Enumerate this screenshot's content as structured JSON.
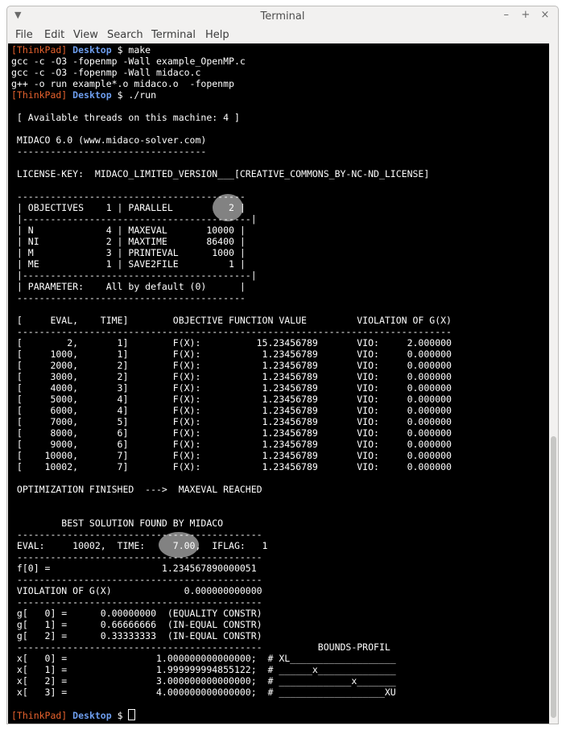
{
  "window": {
    "title": "Terminal",
    "menu_icon": "chevron-down-icon",
    "controls": [
      "–",
      "+",
      "×"
    ]
  },
  "menubar": [
    "File",
    "Edit",
    "View",
    "Search",
    "Terminal",
    "Help"
  ],
  "terminal": {
    "lines": [
      [
        {
          "t": "[ThinkPad] ",
          "c": "host"
        },
        {
          "t": "Desktop",
          "c": "dir"
        },
        {
          "t": " $ make"
        }
      ],
      [
        {
          "t": "gcc -c -O3 -fopenmp -Wall example_OpenMP.c"
        }
      ],
      [
        {
          "t": "gcc -c -O3 -fopenmp -Wall midaco.c"
        }
      ],
      [
        {
          "t": "g++ -o run example*.o midaco.o  -fopenmp"
        }
      ],
      [
        {
          "t": "[ThinkPad] ",
          "c": "host"
        },
        {
          "t": "Desktop",
          "c": "dir"
        },
        {
          "t": " $ ./run"
        }
      ],
      [
        {
          "t": ""
        }
      ],
      [
        {
          "t": " [ Available threads on this machine: 4 ]"
        }
      ],
      [
        {
          "t": ""
        }
      ],
      [
        {
          "t": " MIDACO 6.0 (www.midaco-solver.com)"
        }
      ],
      [
        {
          "t": " ----------------------------------"
        }
      ],
      [
        {
          "t": ""
        }
      ],
      [
        {
          "t": " LICENSE-KEY:  MIDACO_LIMITED_VERSION___[CREATIVE_COMMONS_BY-NC-ND_LICENSE]"
        }
      ],
      [
        {
          "t": ""
        }
      ],
      [
        {
          "t": " -----------------------------------------"
        }
      ],
      [
        {
          "t": " | OBJECTIVES    1 | PARALLEL          2 |"
        }
      ],
      [
        {
          "t": " |-----------------------------------------|"
        }
      ],
      [
        {
          "t": " | N             4 | MAXEVAL       10000 |"
        }
      ],
      [
        {
          "t": " | NI            2 | MAXTIME       86400 |"
        }
      ],
      [
        {
          "t": " | M             3 | PRINTEVAL      1000 |"
        }
      ],
      [
        {
          "t": " | ME            1 | SAVE2FILE         1 |"
        }
      ],
      [
        {
          "t": " |-----------------------------------------|"
        }
      ],
      [
        {
          "t": " | PARAMETER:    All by default (0)      |"
        }
      ],
      [
        {
          "t": " -----------------------------------------"
        }
      ],
      [
        {
          "t": ""
        }
      ],
      [
        {
          "t": " [     EVAL,    TIME]        OBJECTIVE FUNCTION VALUE         VIOLATION OF G(X)"
        }
      ],
      [
        {
          "t": " ------------------------------------------------------------------------------"
        }
      ],
      [
        {
          "t": " [        2,       1]        F(X):          15.23456789       VIO:     2.000000"
        }
      ],
      [
        {
          "t": " [     1000,       1]        F(X):           1.23456789       VIO:     0.000000"
        }
      ],
      [
        {
          "t": " [     2000,       2]        F(X):           1.23456789       VIO:     0.000000"
        }
      ],
      [
        {
          "t": " [     3000,       2]        F(X):           1.23456789       VIO:     0.000000"
        }
      ],
      [
        {
          "t": " [     4000,       3]        F(X):           1.23456789       VIO:     0.000000"
        }
      ],
      [
        {
          "t": " [     5000,       4]        F(X):           1.23456789       VIO:     0.000000"
        }
      ],
      [
        {
          "t": " [     6000,       4]        F(X):           1.23456789       VIO:     0.000000"
        }
      ],
      [
        {
          "t": " [     7000,       5]        F(X):           1.23456789       VIO:     0.000000"
        }
      ],
      [
        {
          "t": " [     8000,       6]        F(X):           1.23456789       VIO:     0.000000"
        }
      ],
      [
        {
          "t": " [     9000,       6]        F(X):           1.23456789       VIO:     0.000000"
        }
      ],
      [
        {
          "t": " [    10000,       7]        F(X):           1.23456789       VIO:     0.000000"
        }
      ],
      [
        {
          "t": " [    10002,       7]        F(X):           1.23456789       VIO:     0.000000"
        }
      ],
      [
        {
          "t": ""
        }
      ],
      [
        {
          "t": " OPTIMIZATION FINISHED  --->  MAXEVAL REACHED"
        }
      ],
      [
        {
          "t": ""
        }
      ],
      [
        {
          "t": ""
        }
      ],
      [
        {
          "t": "         BEST SOLUTION FOUND BY MIDACO"
        }
      ],
      [
        {
          "t": " --------------------------------------------"
        }
      ],
      [
        {
          "t": " EVAL:     10002,  TIME:     7.00,  IFLAG:   1"
        }
      ],
      [
        {
          "t": " --------------------------------------------"
        }
      ],
      [
        {
          "t": " f[0] =                    1.234567890000051"
        }
      ],
      [
        {
          "t": " --------------------------------------------"
        }
      ],
      [
        {
          "t": " VIOLATION OF G(X)             0.000000000000"
        }
      ],
      [
        {
          "t": " --------------------------------------------"
        }
      ],
      [
        {
          "t": " g[   0] =      0.00000000  (EQUALITY CONSTR)"
        }
      ],
      [
        {
          "t": " g[   1] =      0.66666666  (IN-EQUAL CONSTR)"
        }
      ],
      [
        {
          "t": " g[   2] =      0.33333333  (IN-EQUAL CONSTR)"
        }
      ],
      [
        {
          "t": " --------------------------------------------          BOUNDS-PROFIL"
        }
      ],
      [
        {
          "t": " x[   0] =                1.000000000000000;  # XL___________________"
        }
      ],
      [
        {
          "t": " x[   1] =                1.999999994855122;  # ______x______________"
        }
      ],
      [
        {
          "t": " x[   2] =                3.000000000000000;  # _____________x_______"
        }
      ],
      [
        {
          "t": " x[   3] =                4.000000000000000;  # ___________________XU"
        }
      ],
      [
        {
          "t": ""
        }
      ],
      [
        {
          "t": "[ThinkPad] ",
          "c": "host"
        },
        {
          "t": "Desktop",
          "c": "dir"
        },
        {
          "t": " $ "
        },
        {
          "cursor": true
        }
      ]
    ]
  },
  "highlights": {
    "parallel_value": "2",
    "time_value": "7.00,"
  },
  "colors": {
    "host": "#e8622d",
    "dir": "#6d9ded",
    "text": "#ffffff",
    "background": "#000000",
    "highlight": "#c8c8c8"
  }
}
